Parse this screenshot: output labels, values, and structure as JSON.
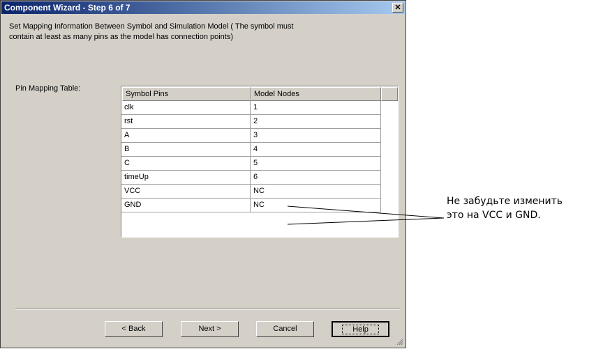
{
  "dialog": {
    "title": "Component Wizard - Step 6 of 7",
    "close_glyph": "✕",
    "instruction_line1": "Set Mapping Information Between Symbol and Simulation Model ( The symbol must",
    "instruction_line2": "contain at least as many pins as the model has connection points)",
    "pin_mapping_label": "Pin Mapping Table:"
  },
  "table": {
    "headers": [
      "Symbol Pins",
      "Model Nodes"
    ],
    "rows": [
      {
        "pin": "clk",
        "node": "1"
      },
      {
        "pin": "rst",
        "node": "2"
      },
      {
        "pin": "A",
        "node": "3"
      },
      {
        "pin": "B",
        "node": "4"
      },
      {
        "pin": "C",
        "node": "5"
      },
      {
        "pin": "timeUp",
        "node": "6"
      },
      {
        "pin": "VCC",
        "node": "NC"
      },
      {
        "pin": "GND",
        "node": "NC"
      }
    ]
  },
  "buttons": {
    "back": "< Back",
    "next": "Next >",
    "cancel": "Cancel",
    "help": "Help"
  },
  "annotation": {
    "line1": "Не забудьте изменить",
    "line2": "это на VCC и GND."
  },
  "colors": {
    "dialog_bg": "#d4d0c8",
    "titlebar_start": "#0a246a",
    "titlebar_end": "#a6caf0"
  }
}
